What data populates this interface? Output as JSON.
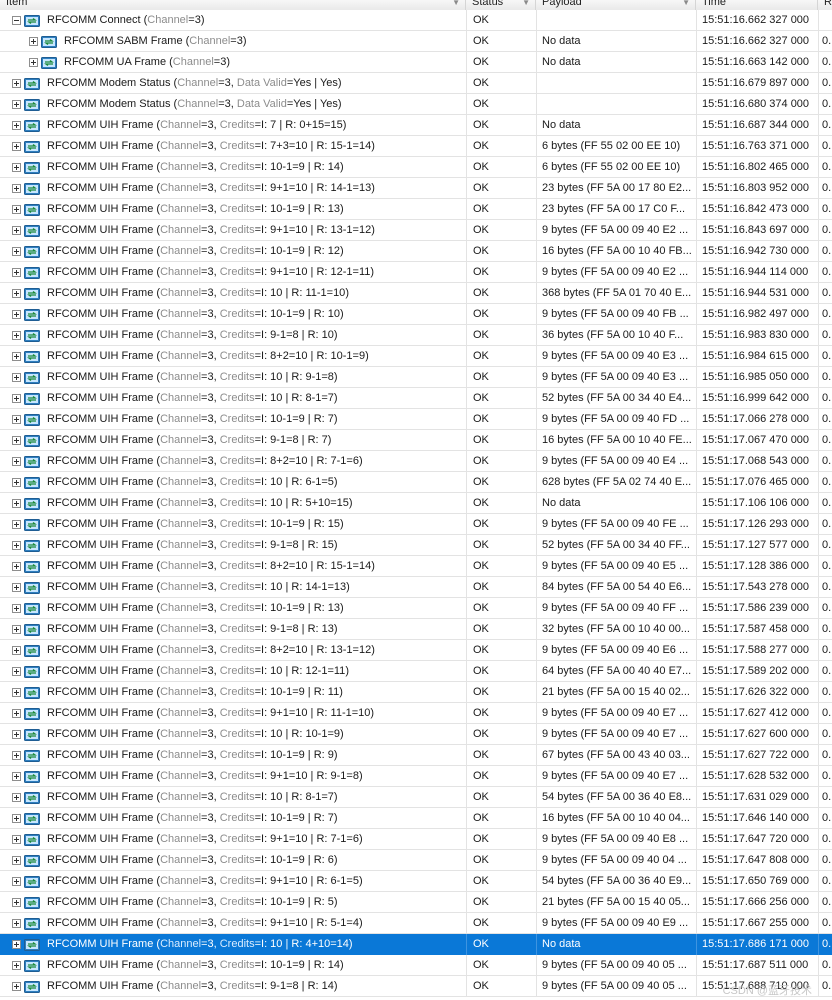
{
  "columns": {
    "item": "Item",
    "status": "Status",
    "payload": "Payload",
    "time": "Time",
    "extra": "R"
  },
  "watermark": "CSDN @蓝牙技术",
  "rows": [
    {
      "indent": 0,
      "expander": "minus",
      "name": "RFCOMM Connect",
      "params": [
        [
          "Channel",
          "3"
        ]
      ],
      "status": "OK",
      "payload": "",
      "time": "15:51:16.662 327 000",
      "extra": "",
      "selected": false
    },
    {
      "indent": 1,
      "expander": "plus",
      "name": "RFCOMM SABM Frame",
      "params": [
        [
          "Channel",
          "3"
        ]
      ],
      "status": "OK",
      "payload": "No data",
      "time": "15:51:16.662 327 000",
      "extra": "0.",
      "selected": false
    },
    {
      "indent": 1,
      "expander": "plus",
      "name": "RFCOMM UA Frame",
      "params": [
        [
          "Channel",
          "3"
        ]
      ],
      "status": "OK",
      "payload": "No data",
      "time": "15:51:16.663 142 000",
      "extra": "0.",
      "selected": false
    },
    {
      "indent": 0,
      "expander": "plus",
      "name": "RFCOMM Modem Status",
      "params": [
        [
          "Channel",
          "3"
        ],
        [
          "Data Valid",
          "Yes | Yes"
        ]
      ],
      "status": "OK",
      "payload": "",
      "time": "15:51:16.679 897 000",
      "extra": "0.",
      "selected": false
    },
    {
      "indent": 0,
      "expander": "plus",
      "name": "RFCOMM Modem Status",
      "params": [
        [
          "Channel",
          "3"
        ],
        [
          "Data Valid",
          "Yes | Yes"
        ]
      ],
      "status": "OK",
      "payload": "",
      "time": "15:51:16.680 374 000",
      "extra": "0.",
      "selected": false
    },
    {
      "indent": 0,
      "expander": "plus",
      "name": "RFCOMM UIH Frame",
      "params": [
        [
          "Channel",
          "3"
        ],
        [
          "Credits",
          "I: 7 | R: 0+15=15"
        ]
      ],
      "status": "OK",
      "payload": "No data",
      "time": "15:51:16.687 344 000",
      "extra": "0.",
      "selected": false
    },
    {
      "indent": 0,
      "expander": "plus",
      "name": "RFCOMM UIH Frame",
      "params": [
        [
          "Channel",
          "3"
        ],
        [
          "Credits",
          "I: 7+3=10 | R: 15-1=14"
        ]
      ],
      "status": "OK",
      "payload": "6 bytes (FF 55 02 00 EE 10)",
      "time": "15:51:16.763 371 000",
      "extra": "0.",
      "selected": false
    },
    {
      "indent": 0,
      "expander": "plus",
      "name": "RFCOMM UIH Frame",
      "params": [
        [
          "Channel",
          "3"
        ],
        [
          "Credits",
          "I: 10-1=9 | R: 14"
        ]
      ],
      "status": "OK",
      "payload": "6 bytes (FF 55 02 00 EE 10)",
      "time": "15:51:16.802 465 000",
      "extra": "0.",
      "selected": false
    },
    {
      "indent": 0,
      "expander": "plus",
      "name": "RFCOMM UIH Frame",
      "params": [
        [
          "Channel",
          "3"
        ],
        [
          "Credits",
          "I: 9+1=10 | R: 14-1=13"
        ]
      ],
      "status": "OK",
      "payload": "23 bytes (FF 5A 00 17 80 E2...",
      "time": "15:51:16.803 952 000",
      "extra": "0.",
      "selected": false
    },
    {
      "indent": 0,
      "expander": "plus",
      "name": "RFCOMM UIH Frame",
      "params": [
        [
          "Channel",
          "3"
        ],
        [
          "Credits",
          "I: 10-1=9 | R: 13"
        ]
      ],
      "status": "OK",
      "payload": "23 bytes (FF 5A 00 17 C0 F...",
      "time": "15:51:16.842 473 000",
      "extra": "0.",
      "selected": false
    },
    {
      "indent": 0,
      "expander": "plus",
      "name": "RFCOMM UIH Frame",
      "params": [
        [
          "Channel",
          "3"
        ],
        [
          "Credits",
          "I: 9+1=10 | R: 13-1=12"
        ]
      ],
      "status": "OK",
      "payload": "9 bytes (FF 5A 00 09 40 E2 ...",
      "time": "15:51:16.843 697 000",
      "extra": "0.",
      "selected": false
    },
    {
      "indent": 0,
      "expander": "plus",
      "name": "RFCOMM UIH Frame",
      "params": [
        [
          "Channel",
          "3"
        ],
        [
          "Credits",
          "I: 10-1=9 | R: 12"
        ]
      ],
      "status": "OK",
      "payload": "16 bytes (FF 5A 00 10 40 FB...",
      "time": "15:51:16.942 730 000",
      "extra": "0.",
      "selected": false
    },
    {
      "indent": 0,
      "expander": "plus",
      "name": "RFCOMM UIH Frame",
      "params": [
        [
          "Channel",
          "3"
        ],
        [
          "Credits",
          "I: 9+1=10 | R: 12-1=11"
        ]
      ],
      "status": "OK",
      "payload": "9 bytes (FF 5A 00 09 40 E2 ...",
      "time": "15:51:16.944 114 000",
      "extra": "0.",
      "selected": false
    },
    {
      "indent": 0,
      "expander": "plus",
      "name": "RFCOMM UIH Frame",
      "params": [
        [
          "Channel",
          "3"
        ],
        [
          "Credits",
          "I: 10 | R: 11-1=10"
        ]
      ],
      "status": "OK",
      "payload": "368 bytes (FF 5A 01 70 40 E...",
      "time": "15:51:16.944 531 000",
      "extra": "0.",
      "selected": false
    },
    {
      "indent": 0,
      "expander": "plus",
      "name": "RFCOMM UIH Frame",
      "params": [
        [
          "Channel",
          "3"
        ],
        [
          "Credits",
          "I: 10-1=9 | R: 10"
        ]
      ],
      "status": "OK",
      "payload": "9 bytes (FF 5A 00 09 40 FB ...",
      "time": "15:51:16.982 497 000",
      "extra": "0.",
      "selected": false
    },
    {
      "indent": 0,
      "expander": "plus",
      "name": "RFCOMM UIH Frame",
      "params": [
        [
          "Channel",
          "3"
        ],
        [
          "Credits",
          "I: 9-1=8 | R: 10"
        ]
      ],
      "status": "OK",
      "payload": "36 bytes (FF 5A 00 10 40 F...",
      "time": "15:51:16.983 830 000",
      "extra": "0.",
      "selected": false
    },
    {
      "indent": 0,
      "expander": "plus",
      "name": "RFCOMM UIH Frame",
      "params": [
        [
          "Channel",
          "3"
        ],
        [
          "Credits",
          "I: 8+2=10 | R: 10-1=9"
        ]
      ],
      "status": "OK",
      "payload": "9 bytes (FF 5A 00 09 40 E3 ...",
      "time": "15:51:16.984 615 000",
      "extra": "0.",
      "selected": false
    },
    {
      "indent": 0,
      "expander": "plus",
      "name": "RFCOMM UIH Frame",
      "params": [
        [
          "Channel",
          "3"
        ],
        [
          "Credits",
          "I: 10 | R: 9-1=8"
        ]
      ],
      "status": "OK",
      "payload": "9 bytes (FF 5A 00 09 40 E3 ...",
      "time": "15:51:16.985 050 000",
      "extra": "0.",
      "selected": false
    },
    {
      "indent": 0,
      "expander": "plus",
      "name": "RFCOMM UIH Frame",
      "params": [
        [
          "Channel",
          "3"
        ],
        [
          "Credits",
          "I: 10 | R: 8-1=7"
        ]
      ],
      "status": "OK",
      "payload": "52 bytes (FF 5A 00 34 40 E4...",
      "time": "15:51:16.999 642 000",
      "extra": "0.",
      "selected": false
    },
    {
      "indent": 0,
      "expander": "plus",
      "name": "RFCOMM UIH Frame",
      "params": [
        [
          "Channel",
          "3"
        ],
        [
          "Credits",
          "I: 10-1=9 | R: 7"
        ]
      ],
      "status": "OK",
      "payload": "9 bytes (FF 5A 00 09 40 FD ...",
      "time": "15:51:17.066 278 000",
      "extra": "0.",
      "selected": false
    },
    {
      "indent": 0,
      "expander": "plus",
      "name": "RFCOMM UIH Frame",
      "params": [
        [
          "Channel",
          "3"
        ],
        [
          "Credits",
          "I: 9-1=8 | R: 7"
        ]
      ],
      "status": "OK",
      "payload": "16 bytes (FF 5A 00 10 40 FE...",
      "time": "15:51:17.067 470 000",
      "extra": "0.",
      "selected": false
    },
    {
      "indent": 0,
      "expander": "plus",
      "name": "RFCOMM UIH Frame",
      "params": [
        [
          "Channel",
          "3"
        ],
        [
          "Credits",
          "I: 8+2=10 | R: 7-1=6"
        ]
      ],
      "status": "OK",
      "payload": "9 bytes (FF 5A 00 09 40 E4 ...",
      "time": "15:51:17.068 543 000",
      "extra": "0.",
      "selected": false
    },
    {
      "indent": 0,
      "expander": "plus",
      "name": "RFCOMM UIH Frame",
      "params": [
        [
          "Channel",
          "3"
        ],
        [
          "Credits",
          "I: 10 | R: 6-1=5"
        ]
      ],
      "status": "OK",
      "payload": "628 bytes (FF 5A 02 74 40 E...",
      "time": "15:51:17.076 465 000",
      "extra": "0.",
      "selected": false
    },
    {
      "indent": 0,
      "expander": "plus",
      "name": "RFCOMM UIH Frame",
      "params": [
        [
          "Channel",
          "3"
        ],
        [
          "Credits",
          "I: 10 | R: 5+10=15"
        ]
      ],
      "status": "OK",
      "payload": "No data",
      "time": "15:51:17.106 106 000",
      "extra": "0.",
      "selected": false
    },
    {
      "indent": 0,
      "expander": "plus",
      "name": "RFCOMM UIH Frame",
      "params": [
        [
          "Channel",
          "3"
        ],
        [
          "Credits",
          "I: 10-1=9 | R: 15"
        ]
      ],
      "status": "OK",
      "payload": "9 bytes (FF 5A 00 09 40 FE ...",
      "time": "15:51:17.126 293 000",
      "extra": "0.",
      "selected": false
    },
    {
      "indent": 0,
      "expander": "plus",
      "name": "RFCOMM UIH Frame",
      "params": [
        [
          "Channel",
          "3"
        ],
        [
          "Credits",
          "I: 9-1=8 | R: 15"
        ]
      ],
      "status": "OK",
      "payload": "52 bytes (FF 5A 00 34 40 FF...",
      "time": "15:51:17.127 577 000",
      "extra": "0.",
      "selected": false
    },
    {
      "indent": 0,
      "expander": "plus",
      "name": "RFCOMM UIH Frame",
      "params": [
        [
          "Channel",
          "3"
        ],
        [
          "Credits",
          "I: 8+2=10 | R: 15-1=14"
        ]
      ],
      "status": "OK",
      "payload": "9 bytes (FF 5A 00 09 40 E5 ...",
      "time": "15:51:17.128 386 000",
      "extra": "0.",
      "selected": false
    },
    {
      "indent": 0,
      "expander": "plus",
      "name": "RFCOMM UIH Frame",
      "params": [
        [
          "Channel",
          "3"
        ],
        [
          "Credits",
          "I: 10 | R: 14-1=13"
        ]
      ],
      "status": "OK",
      "payload": "84 bytes (FF 5A 00 54 40 E6...",
      "time": "15:51:17.543 278 000",
      "extra": "0.",
      "selected": false
    },
    {
      "indent": 0,
      "expander": "plus",
      "name": "RFCOMM UIH Frame",
      "params": [
        [
          "Channel",
          "3"
        ],
        [
          "Credits",
          "I: 10-1=9 | R: 13"
        ]
      ],
      "status": "OK",
      "payload": "9 bytes (FF 5A 00 09 40 FF ...",
      "time": "15:51:17.586 239 000",
      "extra": "0.",
      "selected": false
    },
    {
      "indent": 0,
      "expander": "plus",
      "name": "RFCOMM UIH Frame",
      "params": [
        [
          "Channel",
          "3"
        ],
        [
          "Credits",
          "I: 9-1=8 | R: 13"
        ]
      ],
      "status": "OK",
      "payload": "32 bytes (FF 5A 00 10 40 00...",
      "time": "15:51:17.587 458 000",
      "extra": "0.",
      "selected": false
    },
    {
      "indent": 0,
      "expander": "plus",
      "name": "RFCOMM UIH Frame",
      "params": [
        [
          "Channel",
          "3"
        ],
        [
          "Credits",
          "I: 8+2=10 | R: 13-1=12"
        ]
      ],
      "status": "OK",
      "payload": "9 bytes (FF 5A 00 09 40 E6 ...",
      "time": "15:51:17.588 277 000",
      "extra": "0.",
      "selected": false
    },
    {
      "indent": 0,
      "expander": "plus",
      "name": "RFCOMM UIH Frame",
      "params": [
        [
          "Channel",
          "3"
        ],
        [
          "Credits",
          "I: 10 | R: 12-1=11"
        ]
      ],
      "status": "OK",
      "payload": "64 bytes (FF 5A 00 40 40 E7...",
      "time": "15:51:17.589 202 000",
      "extra": "0.",
      "selected": false
    },
    {
      "indent": 0,
      "expander": "plus",
      "name": "RFCOMM UIH Frame",
      "params": [
        [
          "Channel",
          "3"
        ],
        [
          "Credits",
          "I: 10-1=9 | R: 11"
        ]
      ],
      "status": "OK",
      "payload": "21 bytes (FF 5A 00 15 40 02...",
      "time": "15:51:17.626 322 000",
      "extra": "0.",
      "selected": false
    },
    {
      "indent": 0,
      "expander": "plus",
      "name": "RFCOMM UIH Frame",
      "params": [
        [
          "Channel",
          "3"
        ],
        [
          "Credits",
          "I: 9+1=10 | R: 11-1=10"
        ]
      ],
      "status": "OK",
      "payload": "9 bytes (FF 5A 00 09 40 E7 ...",
      "time": "15:51:17.627 412 000",
      "extra": "0.",
      "selected": false
    },
    {
      "indent": 0,
      "expander": "plus",
      "name": "RFCOMM UIH Frame",
      "params": [
        [
          "Channel",
          "3"
        ],
        [
          "Credits",
          "I: 10 | R: 10-1=9"
        ]
      ],
      "status": "OK",
      "payload": "9 bytes (FF 5A 00 09 40 E7 ...",
      "time": "15:51:17.627 600 000",
      "extra": "0.",
      "selected": false
    },
    {
      "indent": 0,
      "expander": "plus",
      "name": "RFCOMM UIH Frame",
      "params": [
        [
          "Channel",
          "3"
        ],
        [
          "Credits",
          "I: 10-1=9 | R: 9"
        ]
      ],
      "status": "OK",
      "payload": "67 bytes (FF 5A 00 43 40 03...",
      "time": "15:51:17.627 722 000",
      "extra": "0.",
      "selected": false
    },
    {
      "indent": 0,
      "expander": "plus",
      "name": "RFCOMM UIH Frame",
      "params": [
        [
          "Channel",
          "3"
        ],
        [
          "Credits",
          "I: 9+1=10 | R: 9-1=8"
        ]
      ],
      "status": "OK",
      "payload": "9 bytes (FF 5A 00 09 40 E7 ...",
      "time": "15:51:17.628 532 000",
      "extra": "0.",
      "selected": false
    },
    {
      "indent": 0,
      "expander": "plus",
      "name": "RFCOMM UIH Frame",
      "params": [
        [
          "Channel",
          "3"
        ],
        [
          "Credits",
          "I: 10 | R: 8-1=7"
        ]
      ],
      "status": "OK",
      "payload": "54 bytes (FF 5A 00 36 40 E8...",
      "time": "15:51:17.631 029 000",
      "extra": "0.",
      "selected": false
    },
    {
      "indent": 0,
      "expander": "plus",
      "name": "RFCOMM UIH Frame",
      "params": [
        [
          "Channel",
          "3"
        ],
        [
          "Credits",
          "I: 10-1=9 | R: 7"
        ]
      ],
      "status": "OK",
      "payload": "16 bytes (FF 5A 00 10 40 04...",
      "time": "15:51:17.646 140 000",
      "extra": "0.",
      "selected": false
    },
    {
      "indent": 0,
      "expander": "plus",
      "name": "RFCOMM UIH Frame",
      "params": [
        [
          "Channel",
          "3"
        ],
        [
          "Credits",
          "I: 9+1=10 | R: 7-1=6"
        ]
      ],
      "status": "OK",
      "payload": "9 bytes (FF 5A 00 09 40 E8 ...",
      "time": "15:51:17.647 720 000",
      "extra": "0.",
      "selected": false
    },
    {
      "indent": 0,
      "expander": "plus",
      "name": "RFCOMM UIH Frame",
      "params": [
        [
          "Channel",
          "3"
        ],
        [
          "Credits",
          "I: 10-1=9 | R: 6"
        ]
      ],
      "status": "OK",
      "payload": "9 bytes (FF 5A 00 09 40 04 ...",
      "time": "15:51:17.647 808 000",
      "extra": "0.",
      "selected": false
    },
    {
      "indent": 0,
      "expander": "plus",
      "name": "RFCOMM UIH Frame",
      "params": [
        [
          "Channel",
          "3"
        ],
        [
          "Credits",
          "I: 9+1=10 | R: 6-1=5"
        ]
      ],
      "status": "OK",
      "payload": "54 bytes (FF 5A 00 36 40 E9...",
      "time": "15:51:17.650 769 000",
      "extra": "0.",
      "selected": false
    },
    {
      "indent": 0,
      "expander": "plus",
      "name": "RFCOMM UIH Frame",
      "params": [
        [
          "Channel",
          "3"
        ],
        [
          "Credits",
          "I: 10-1=9 | R: 5"
        ]
      ],
      "status": "OK",
      "payload": "21 bytes (FF 5A 00 15 40 05...",
      "time": "15:51:17.666 256 000",
      "extra": "0.",
      "selected": false
    },
    {
      "indent": 0,
      "expander": "plus",
      "name": "RFCOMM UIH Frame",
      "params": [
        [
          "Channel",
          "3"
        ],
        [
          "Credits",
          "I: 9+1=10 | R: 5-1=4"
        ]
      ],
      "status": "OK",
      "payload": "9 bytes (FF 5A 00 09 40 E9 ...",
      "time": "15:51:17.667 255 000",
      "extra": "0.",
      "selected": false
    },
    {
      "indent": 0,
      "expander": "plus",
      "name": "RFCOMM UIH Frame",
      "params": [
        [
          "Channel",
          "3"
        ],
        [
          "Credits",
          "I: 10 | R: 4+10=14"
        ]
      ],
      "status": "OK",
      "payload": "No data",
      "time": "15:51:17.686 171 000",
      "extra": "0.",
      "selected": true
    },
    {
      "indent": 0,
      "expander": "plus",
      "name": "RFCOMM UIH Frame",
      "params": [
        [
          "Channel",
          "3"
        ],
        [
          "Credits",
          "I: 10-1=9 | R: 14"
        ]
      ],
      "status": "OK",
      "payload": "9 bytes (FF 5A 00 09 40 05 ...",
      "time": "15:51:17.687 511 000",
      "extra": "0.",
      "selected": false
    },
    {
      "indent": 0,
      "expander": "plus",
      "name": "RFCOMM UIH Frame",
      "params": [
        [
          "Channel",
          "3"
        ],
        [
          "Credits",
          "I: 9-1=8 | R: 14"
        ]
      ],
      "status": "OK",
      "payload": "9 bytes (FF 5A 00 09 40 05 ...",
      "time": "15:51:17.688 710 000",
      "extra": "0.",
      "selected": false
    }
  ]
}
